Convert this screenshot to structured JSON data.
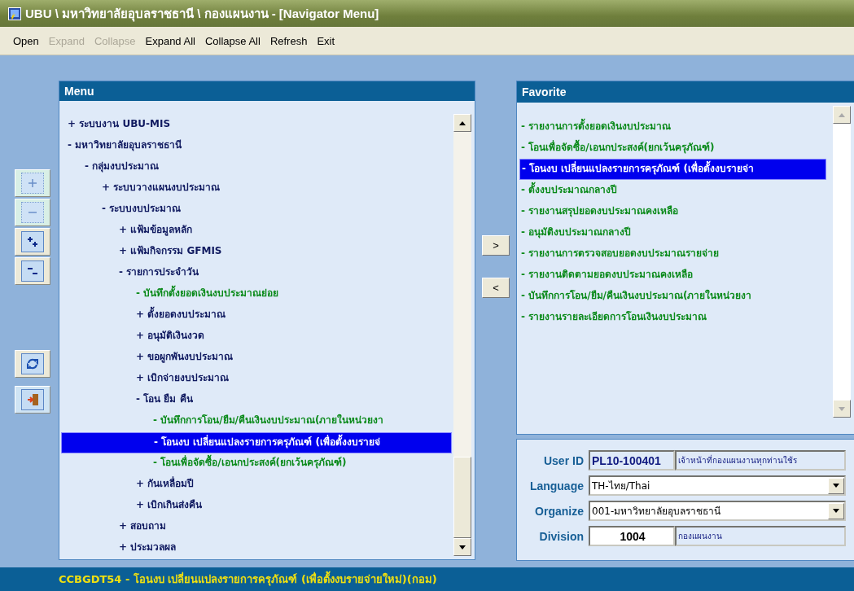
{
  "window": {
    "title": "UBU \\ มหาวิทยาลัยอุบลราชธานี \\ กองแผนงาน - [Navigator Menu]"
  },
  "menu_bar": [
    {
      "label": "Open",
      "disabled": false
    },
    {
      "label": "Expand",
      "disabled": true
    },
    {
      "label": "Collapse",
      "disabled": true
    },
    {
      "label": "Expand All",
      "disabled": false
    },
    {
      "label": "Collapse All",
      "disabled": false
    },
    {
      "label": "Refresh",
      "disabled": false
    },
    {
      "label": "Exit",
      "disabled": false
    }
  ],
  "toolbar": [
    {
      "kind": "expand",
      "disabled": true
    },
    {
      "kind": "collapse",
      "disabled": true
    },
    {
      "kind": "expand-all",
      "disabled": false
    },
    {
      "kind": "collapse-all",
      "disabled": false
    },
    {
      "kind": "refresh",
      "disabled": false
    },
    {
      "kind": "exit",
      "disabled": false
    }
  ],
  "menu": {
    "title": "Menu",
    "tree": [
      {
        "label": "+ ระบบงาน UBU-MIS",
        "kind": "folder",
        "selected": false
      },
      {
        "label": "- มหาวิทยาลัยอุบลราชธานี",
        "kind": "folder",
        "selected": false,
        "children": [
          {
            "label": "- กลุ่มงบประมาณ",
            "kind": "folder",
            "selected": false,
            "children": [
              {
                "label": "+ ระบบวางแผนงบประมาณ",
                "kind": "folder",
                "selected": false
              },
              {
                "label": "- ระบบงบประมาณ",
                "kind": "folder",
                "selected": false,
                "children": [
                  {
                    "label": "+ แฟ้มข้อมูลหลัก",
                    "kind": "folder",
                    "selected": false
                  },
                  {
                    "label": "+ แฟ้มกิจกรรม GFMIS",
                    "kind": "folder",
                    "selected": false
                  },
                  {
                    "label": "- รายการประจำวัน",
                    "kind": "folder",
                    "selected": false,
                    "children": [
                      {
                        "label": "- บันทึกตั้งยอดเงินงบประมาณย่อย",
                        "kind": "leaf",
                        "selected": false
                      },
                      {
                        "label": "+ ตั้งยอดงบประมาณ",
                        "kind": "folder",
                        "selected": false
                      },
                      {
                        "label": "+ อนุมัติเงินงวด",
                        "kind": "folder",
                        "selected": false
                      },
                      {
                        "label": "+ ขอผูกพันงบประมาณ",
                        "kind": "folder",
                        "selected": false
                      },
                      {
                        "label": "+ เบิกจ่ายงบประมาณ",
                        "kind": "folder",
                        "selected": false
                      },
                      {
                        "label": "- โอน ยืม คืน",
                        "kind": "folder",
                        "selected": false,
                        "children": [
                          {
                            "label": "- บันทึกการโอน/ยืม/คืนเงินงบประมาณ(ภายในหน่วยงา",
                            "kind": "leaf",
                            "selected": false
                          },
                          {
                            "label": "- โอนงบ เปลี่ยนแปลงรายการครุภัณฑ์ (เพื่อตั้งงบรายจ่",
                            "kind": "leaf",
                            "selected": true
                          },
                          {
                            "label": "- โอนเพื่อจัดซื้อ/เอนกประสงค์(ยกเว้นครุภัณฑ์)",
                            "kind": "leaf",
                            "selected": false
                          }
                        ]
                      },
                      {
                        "label": "+ กันเหลื่อมปี",
                        "kind": "folder",
                        "selected": false
                      },
                      {
                        "label": "+ เบิกเกินส่งคืน",
                        "kind": "folder",
                        "selected": false
                      }
                    ]
                  },
                  {
                    "label": "+ สอบถาม",
                    "kind": "folder",
                    "selected": false
                  },
                  {
                    "label": "+ ประมวลผล",
                    "kind": "folder",
                    "selected": false
                  }
                ]
              }
            ]
          }
        ]
      }
    ]
  },
  "transfer_buttons": [
    ">",
    "<"
  ],
  "favorite": {
    "title": "Favorite",
    "items": [
      {
        "label": "- รายงานการตั้งยอดเงินงบประมาณ",
        "selected": false
      },
      {
        "label": "- โอนเพื่อจัดซื้อ/เอนกประสงค์(ยกเว้นครุภัณฑ์)",
        "selected": false
      },
      {
        "label": "- โอนงบ เปลี่ยนแปลงรายการครุภัณฑ์ (เพื่อตั้งงบรายจ่า",
        "selected": true
      },
      {
        "label": "- ตั้งงบประมาณกลางปี",
        "selected": false
      },
      {
        "label": "- รายงานสรุปยอดงบประมาณคงเหลือ",
        "selected": false
      },
      {
        "label": "- อนุมัติงบประมาณกลางปี",
        "selected": false
      },
      {
        "label": "- รายงานการตรวจสอบยอดงบประมาณรายจ่าย",
        "selected": false
      },
      {
        "label": "- รายงานติดตามยอดงบประมาณคงเหลือ",
        "selected": false
      },
      {
        "label": "- บันทึกการโอน/ยืม/คืนเงินงบประมาณ(ภายในหน่วยงา",
        "selected": false
      },
      {
        "label": "- รายงานรายละเอียดการโอนเงินงบประมาณ",
        "selected": false
      }
    ]
  },
  "user": {
    "user_id_label": "User ID",
    "user_id": "PL10-100401",
    "user_name": "เจ้าหน้าที่กองแผนงานทุกท่านใช้ร",
    "language_label": "Language",
    "language": "TH-ไทย/Thai",
    "organize_label": "Organize",
    "organize": "001-มหาวิทยาลัยอุบลราชธานี",
    "division_label": "Division",
    "division_code": "1004",
    "division_name": "กองแผนงาน"
  },
  "status_bar": "CCBGDT54 - โอนงบ เปลี่ยนแปลงรายการครุภัณฑ์ (เพื่อตั้งงบรายจ่ายใหม่)(กอม)"
}
